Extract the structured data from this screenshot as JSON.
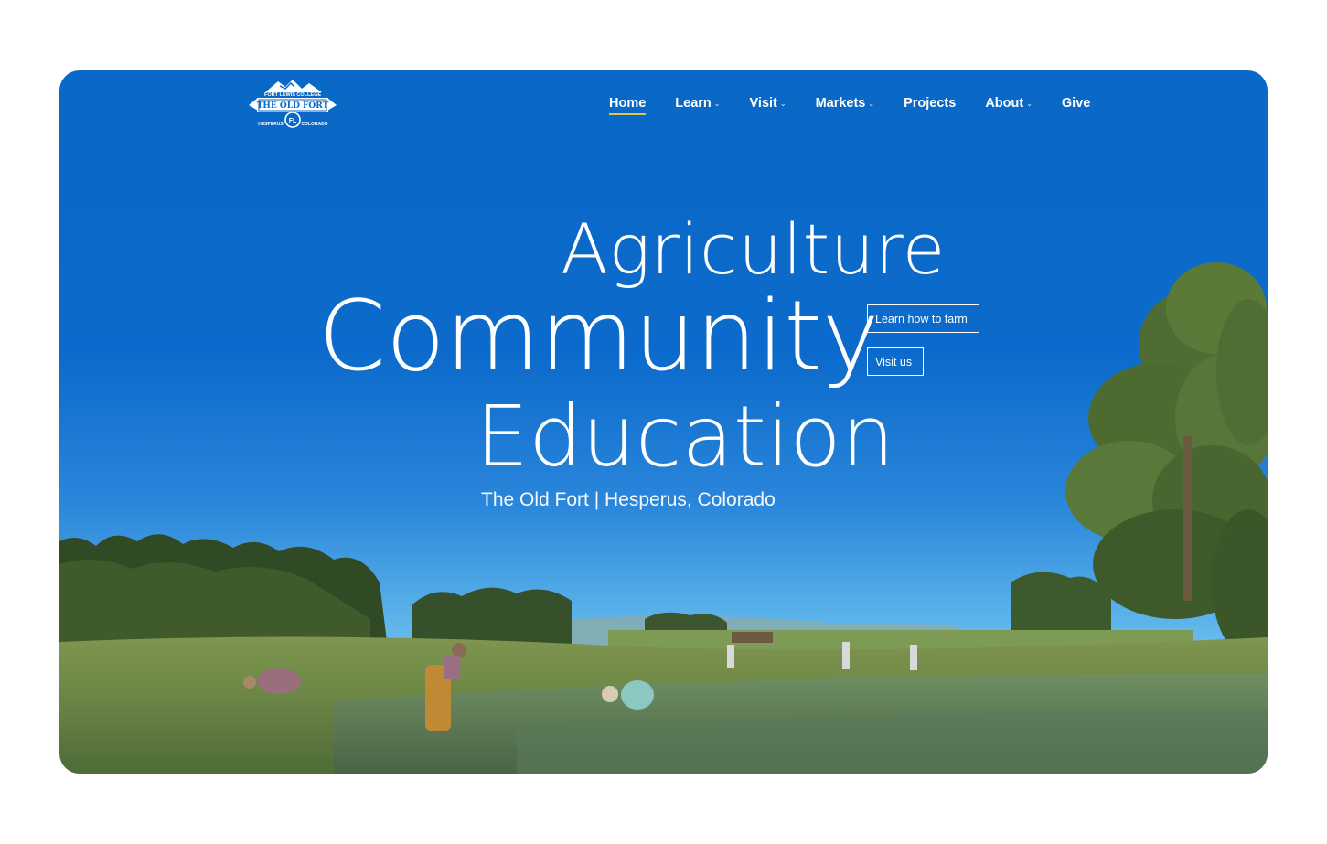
{
  "logo": {
    "top_arc_text": "FORT LEWIS COLLEGE",
    "banner_text": "THE OLD FORT",
    "monogram": "FL",
    "left_text": "HESPERUS",
    "right_text": "COLORADO",
    "icon": "mountain-logo-icon"
  },
  "nav": {
    "items": [
      {
        "label": "Home",
        "active": true,
        "dropdown": false
      },
      {
        "label": "Learn",
        "active": false,
        "dropdown": true
      },
      {
        "label": "Visit",
        "active": false,
        "dropdown": true
      },
      {
        "label": "Markets",
        "active": false,
        "dropdown": true
      },
      {
        "label": "Projects",
        "active": false,
        "dropdown": false
      },
      {
        "label": "About",
        "active": false,
        "dropdown": true
      },
      {
        "label": "Give",
        "active": false,
        "dropdown": false
      }
    ],
    "caret": "⌄",
    "active_underline_color": "#e7c247"
  },
  "hero": {
    "word1": "Agriculture",
    "word2": "Community",
    "word3": "Education",
    "subtitle": "The Old Fort | Hesperus, Colorado",
    "cta_primary": "Learn how to farm",
    "cta_secondary": "Visit us"
  },
  "colors": {
    "sky": "#0a68c6",
    "text": "#ffffff"
  }
}
